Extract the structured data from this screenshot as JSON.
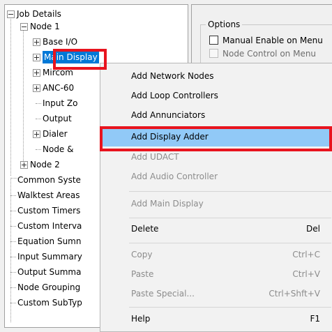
{
  "tree": {
    "job_details": "Job Details",
    "node1": "Node 1",
    "base_io": "Base I/O",
    "main_display": "Main Display",
    "mircom": "Mircom",
    "anc": "ANC-60",
    "input_zones": "Input Zo",
    "output": "Output",
    "dialer": "Dialer",
    "node_and": "Node &",
    "node2": "Node 2",
    "common_system": "Common Syste",
    "walktest_areas": "Walktest Areas",
    "custom_timers": "Custom Timers",
    "custom_intervals": "Custom Interva",
    "equation_summary": "Equation Sumn",
    "input_summary": "Input Summary",
    "output_summary": "Output Summa",
    "node_groupings": "Node Grouping",
    "custom_subtypes": "Custom SubTyp"
  },
  "options": {
    "legend": "Options",
    "manual_enable": "Manual Enable on Menu",
    "node_control": "Node Control on Menu"
  },
  "menu": {
    "add_network_nodes": "Add Network Nodes",
    "add_loop_controllers": "Add Loop Controllers",
    "add_annunciators": "Add Annunciators",
    "add_display_adder": "Add Display Adder",
    "add_udact": "Add UDACT",
    "add_audio_controller": "Add Audio Controller",
    "add_main_display": "Add Main Display",
    "delete": "Delete",
    "delete_shortcut": "Del",
    "copy": "Copy",
    "copy_shortcut": "Ctrl+C",
    "paste": "Paste",
    "paste_shortcut": "Ctrl+V",
    "paste_special": "Paste Special...",
    "paste_special_shortcut": "Ctrl+Shft+V",
    "help": "Help",
    "help_shortcut": "F1"
  },
  "colors": {
    "selection": "#0078d7",
    "hover": "#91c9f7",
    "annotation": "#e8141e"
  }
}
